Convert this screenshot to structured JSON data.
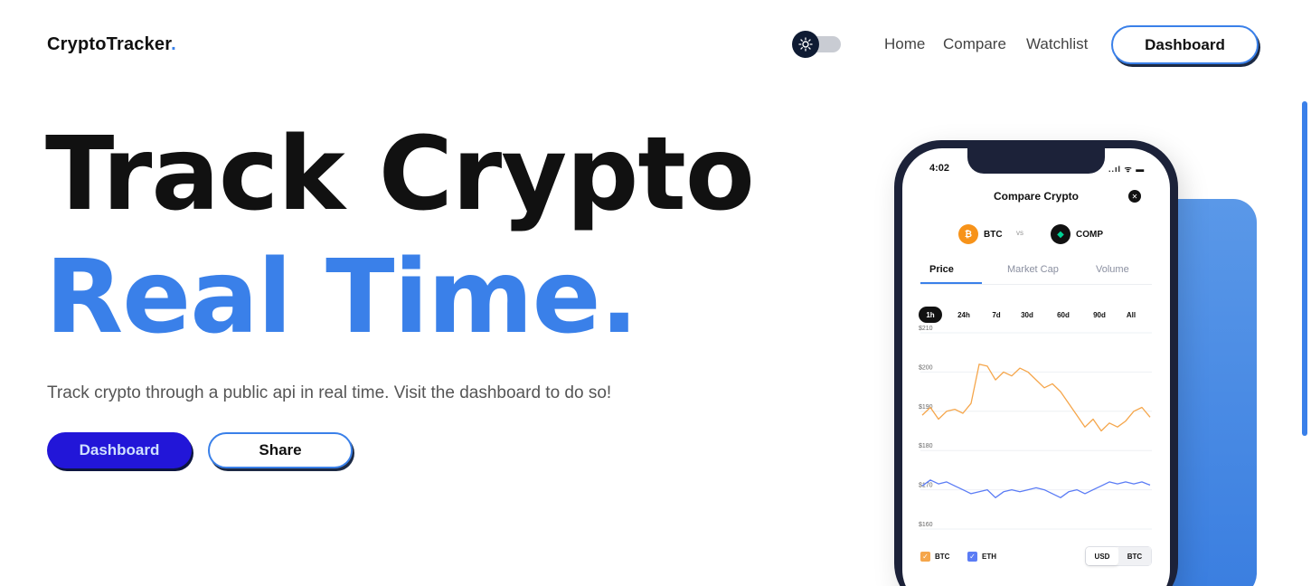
{
  "header": {
    "logo_text": "CryptoTracker",
    "logo_dot": ".",
    "theme_toggle_icon": "sun-icon",
    "nav": [
      "Home",
      "Compare",
      "Watchlist"
    ],
    "dashboard_label": "Dashboard"
  },
  "hero": {
    "line1": "Track Crypto",
    "line2": "Real Time.",
    "subtitle": "Track crypto through a public api in real time. Visit the dashboard to do so!",
    "primary_button": "Dashboard",
    "secondary_button": "Share"
  },
  "colors": {
    "accent": "#3a80e9",
    "primary_button_bg": "#2216d8",
    "btc_line": "#f5a64b",
    "eth_line": "#5b7cf5"
  },
  "phone": {
    "time": "4:02",
    "status_icons": "..ıl ᯤ ▬",
    "title": "Compare Crypto",
    "coin_a": "BTC",
    "coin_b": "COMP",
    "vs": "vs",
    "tabs": [
      "Price",
      "Market Cap",
      "Volume"
    ],
    "ranges": [
      "1h",
      "24h",
      "7d",
      "30d",
      "60d",
      "90d",
      "All"
    ],
    "legend": [
      "BTC",
      "ETH"
    ],
    "currencies": [
      "USD",
      "BTC"
    ]
  },
  "chart_data": {
    "type": "line",
    "ylim": [
      160,
      210
    ],
    "y_ticks": [
      "$210",
      "$200",
      "$190",
      "$180",
      "$170",
      "$160"
    ],
    "series": [
      {
        "name": "BTC",
        "values": [
          189,
          191,
          188,
          190,
          190.5,
          189.5,
          192,
          202,
          201.5,
          198,
          200,
          199,
          201,
          200,
          198,
          196,
          197,
          195,
          192,
          189,
          186,
          188,
          185,
          187,
          186,
          187.5,
          190,
          191,
          188.5
        ]
      },
      {
        "name": "ETH",
        "values": [
          171,
          172.5,
          171.5,
          172,
          171,
          170,
          169,
          169.5,
          170,
          168,
          169.5,
          170,
          169.5,
          170,
          170.5,
          170,
          169,
          168,
          169.5,
          170,
          169,
          170,
          171,
          172,
          171.5,
          172,
          171.5,
          172,
          171.2
        ]
      }
    ]
  }
}
